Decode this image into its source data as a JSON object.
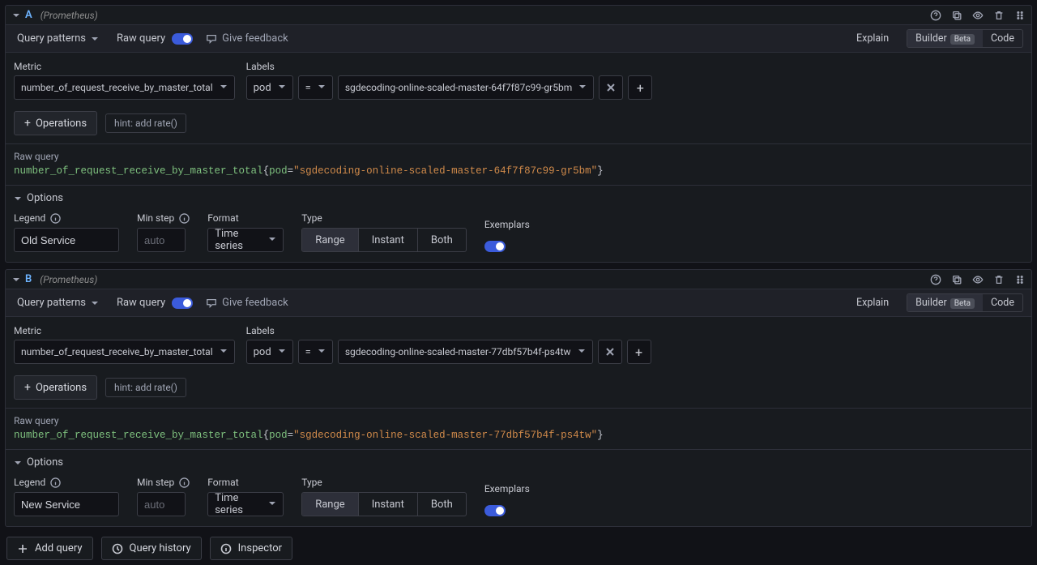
{
  "common": {
    "datasource": "(Prometheus)",
    "patterns_label": "Query patterns",
    "raw_toggle_label": "Raw query",
    "feedback_label": "Give feedback",
    "explain_label": "Explain",
    "builder_label": "Builder",
    "beta_label": "Beta",
    "code_label": "Code",
    "metric_heading": "Metric",
    "labels_heading": "Labels",
    "label_key": "pod",
    "operator": "=",
    "operations_btn": "Operations",
    "hint_label": "hint: add rate()",
    "raw_section_title": "Raw query",
    "options_heading": "Options",
    "legend_label": "Legend",
    "minstep_label": "Min step",
    "format_label": "Format",
    "format_value": "Time series",
    "type_label": "Type",
    "type_options": {
      "range": "Range",
      "instant": "Instant",
      "both": "Both"
    },
    "exemplars_label": "Exemplars",
    "minstep_placeholder": "auto"
  },
  "queries": [
    {
      "letter": "A",
      "metric": "number_of_request_receive_by_master_total",
      "label_value": "sgdecoding-online-scaled-master-64f7f87c99-gr5bm",
      "raw_fn": "number_of_request_receive_by_master_total",
      "raw_str": "\"sgdecoding-online-scaled-master-64f7f87c99-gr5bm\"",
      "legend_value": "Old Service",
      "type_active": "range"
    },
    {
      "letter": "B",
      "metric": "number_of_request_receive_by_master_total",
      "label_value": "sgdecoding-online-scaled-master-77dbf57b4f-ps4tw",
      "raw_fn": "number_of_request_receive_by_master_total",
      "raw_str": "\"sgdecoding-online-scaled-master-77dbf57b4f-ps4tw\"",
      "legend_value": "New Service",
      "type_active": "range"
    }
  ],
  "bottom": {
    "add_query": "Add query",
    "history": "Query history",
    "inspector": "Inspector"
  }
}
